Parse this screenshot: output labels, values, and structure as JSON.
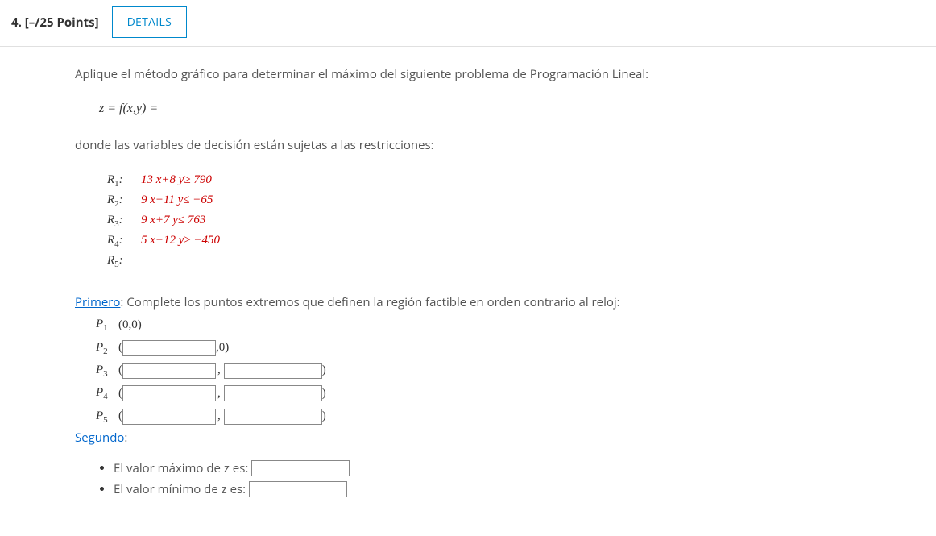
{
  "header": {
    "number": "4.",
    "points": "[–/25 Points]",
    "details_label": "DETAILS"
  },
  "prompt": "Aplique el método gráfico para determinar el máximo del siguiente problema de Programación Lineal:",
  "objective": "z = f(x,y) =",
  "decision_text": "donde las variables de decisión están sujetas a las restricciones:",
  "constraints": [
    {
      "label": "R",
      "sub": "1",
      "expr": "13 x+8 y≥ 790"
    },
    {
      "label": "R",
      "sub": "2",
      "expr": "9 x−11 y≤ −65"
    },
    {
      "label": "R",
      "sub": "3",
      "expr": "9 x+7 y≤ 763"
    },
    {
      "label": "R",
      "sub": "4",
      "expr": "5 x−12 y≥ −450"
    },
    {
      "label": "R",
      "sub": "5",
      "expr": ""
    }
  ],
  "primero": {
    "label": "Primero",
    "rest": ": Complete los puntos extremos que definen la región factible en orden contrario al reloj:",
    "p1": {
      "label": "P",
      "sub": "1",
      "text": "(0,0)"
    },
    "p2": {
      "label": "P",
      "sub": "2",
      "suffix": ",0)"
    },
    "p3": {
      "label": "P",
      "sub": "3"
    },
    "p4": {
      "label": "P",
      "sub": "4"
    },
    "p5": {
      "label": "P",
      "sub": "5"
    }
  },
  "segundo": {
    "label": "Segundo",
    "colon": ":",
    "max_text": "El valor máximo de z es:",
    "min_text": "El valor mínimo de z es:"
  }
}
